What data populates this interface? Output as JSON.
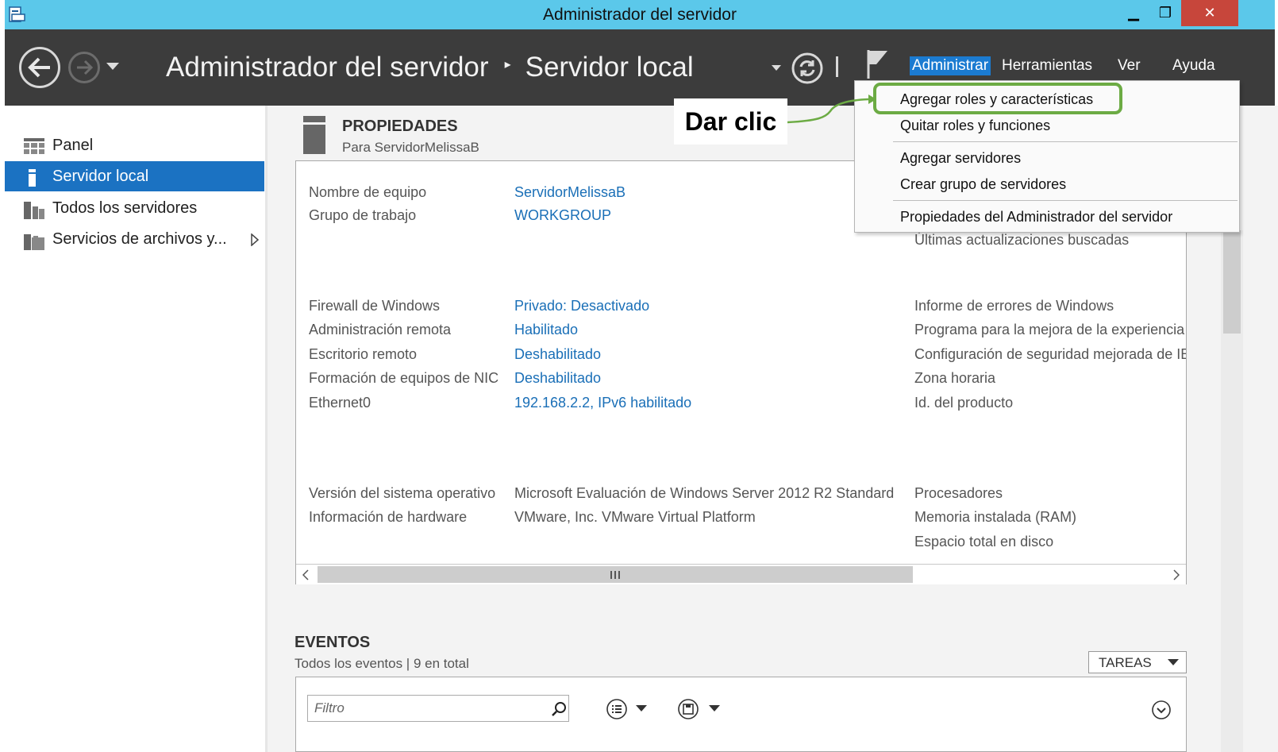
{
  "window": {
    "title": "Administrador del servidor",
    "minimize": "▁",
    "maximize": "❐",
    "close": "✕"
  },
  "header": {
    "breadcrumb_root": "Administrador del servidor",
    "breadcrumb_sep": "▸",
    "breadcrumb_current": "Servidor local",
    "menus": [
      "Administrar",
      "Herramientas",
      "Ver",
      "Ayuda"
    ]
  },
  "sidebar": {
    "items": [
      {
        "label": "Panel",
        "icon": "dashboard-icon"
      },
      {
        "label": "Servidor local",
        "icon": "server-icon",
        "active": true
      },
      {
        "label": "Todos los servidores",
        "icon": "servers-icon"
      },
      {
        "label": "Servicios de archivos y...",
        "icon": "file-services-icon"
      }
    ]
  },
  "properties": {
    "title": "PROPIEDADES",
    "subtitle": "Para ServidorMelissaB",
    "rows_left": [
      {
        "label": "Nombre de equipo",
        "value": "ServidorMelissaB"
      },
      {
        "label": "Grupo de trabajo",
        "value": "WORKGROUP"
      },
      {
        "label": "Firewall de Windows",
        "value": "Privado: Desactivado"
      },
      {
        "label": "Administración remota",
        "value": "Habilitado"
      },
      {
        "label": "Escritorio remoto",
        "value": "Deshabilitado"
      },
      {
        "label": "Formación de equipos de NIC",
        "value": "Deshabilitado"
      },
      {
        "label": "Ethernet0",
        "value": "192.168.2.2, IPv6 habilitado"
      },
      {
        "label": "Versión del sistema operativo",
        "value": "Microsoft Evaluación de Windows Server 2012 R2 Standard"
      },
      {
        "label": "Información de hardware",
        "value": "VMware, Inc. VMware Virtual Platform"
      }
    ],
    "right_labels": [
      "Últimas actualizaciones buscadas",
      "Informe de errores de Windows",
      "Programa para la mejora de la experiencia",
      "Configuración de seguridad mejorada de IE",
      "Zona horaria",
      "Id. del producto",
      "Procesadores",
      "Memoria instalada (RAM)",
      "Espacio total en disco"
    ]
  },
  "events": {
    "title": "EVENTOS",
    "subtitle": "Todos los eventos | 9 en total",
    "tasks_label": "TAREAS",
    "filter_placeholder": "Filtro"
  },
  "dropdown": {
    "items": [
      "Agregar roles y características",
      "Quitar roles y funciones",
      "Agregar servidores",
      "Crear grupo de servidores",
      "Propiedades del Administrador del servidor"
    ]
  },
  "callout": {
    "text": "Dar clic",
    "accent_color": "#6cab44"
  },
  "colors": {
    "titlebar": "#5bc8ea",
    "header": "#3c3c3c",
    "active_item": "#1b72c2",
    "link": "#1a6fb7"
  }
}
